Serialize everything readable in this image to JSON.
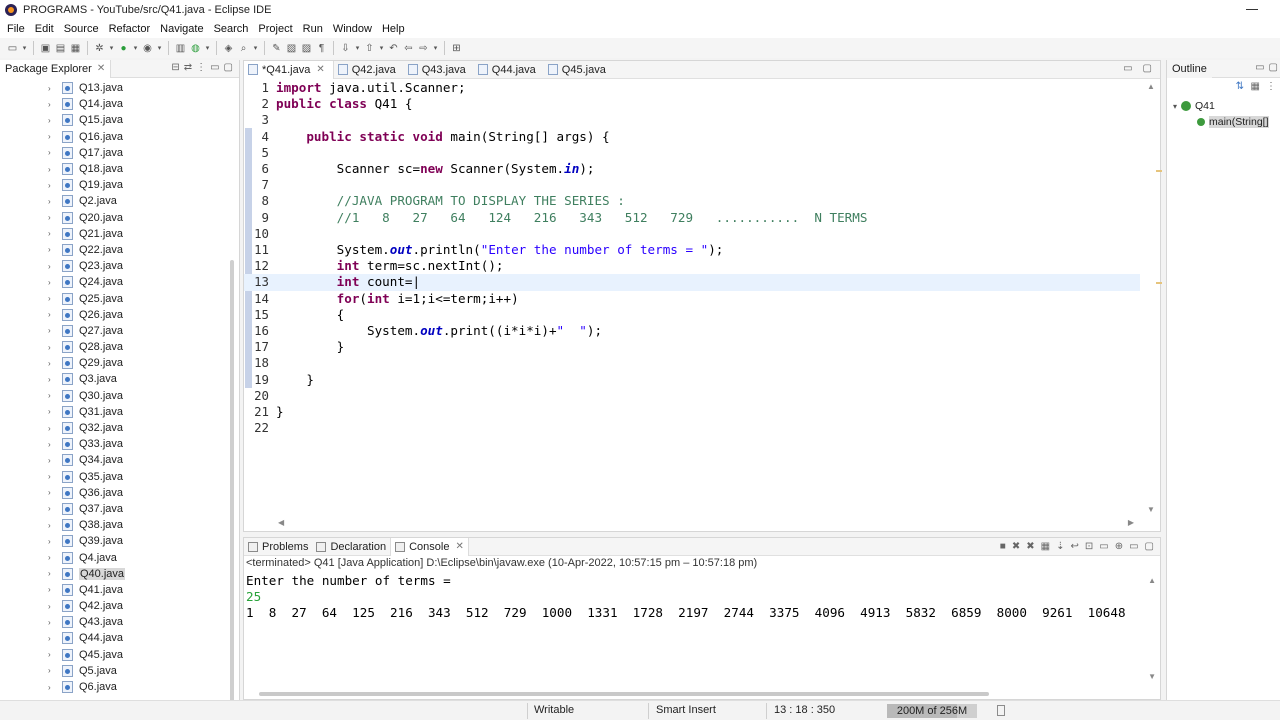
{
  "window": {
    "title": "PROGRAMS - YouTube/src/Q41.java - Eclipse IDE"
  },
  "menu": [
    "File",
    "Edit",
    "Source",
    "Refactor",
    "Navigate",
    "Search",
    "Project",
    "Run",
    "Window",
    "Help"
  ],
  "package_explorer": {
    "title": "Package Explorer",
    "items": [
      "Q13.java",
      "Q14.java",
      "Q15.java",
      "Q16.java",
      "Q17.java",
      "Q18.java",
      "Q19.java",
      "Q2.java",
      "Q20.java",
      "Q21.java",
      "Q22.java",
      "Q23.java",
      "Q24.java",
      "Q25.java",
      "Q26.java",
      "Q27.java",
      "Q28.java",
      "Q29.java",
      "Q3.java",
      "Q30.java",
      "Q31.java",
      "Q32.java",
      "Q33.java",
      "Q34.java",
      "Q35.java",
      "Q36.java",
      "Q37.java",
      "Q38.java",
      "Q39.java",
      "Q4.java",
      "Q40.java",
      "Q41.java",
      "Q42.java",
      "Q43.java",
      "Q44.java",
      "Q45.java",
      "Q5.java",
      "Q6.java"
    ],
    "selected": "Q40.java"
  },
  "editor": {
    "tabs": [
      "*Q41.java",
      "Q42.java",
      "Q43.java",
      "Q44.java",
      "Q45.java"
    ],
    "active_tab": "*Q41.java",
    "line_numbers": [
      "1",
      "2",
      "3",
      "4",
      "5",
      "6",
      "7",
      "8",
      "9",
      "10",
      "11",
      "12",
      "13",
      "14",
      "15",
      "16",
      "17",
      "18",
      "19",
      "20",
      "21",
      "22"
    ],
    "current_line": "13"
  },
  "console": {
    "tabs": [
      "Problems",
      "Declaration",
      "Console"
    ],
    "active_tab": "Console",
    "status": "<terminated> Q41 [Java Application] D:\\Eclipse\\bin\\javaw.exe  (10-Apr-2022, 10:57:15 pm – 10:57:18 pm)",
    "prompt": "Enter the number of terms = ",
    "input": "25",
    "output": "1  8  27  64  125  216  343  512  729  1000  1331  1728  2197  2744  3375  4096  4913  5832  6859  8000  9261  10648"
  },
  "outline": {
    "title": "Outline",
    "class_name": "Q41",
    "method": "main(String[]"
  },
  "statusbar": {
    "mode": "Writable",
    "insert": "Smart Insert",
    "position": "13 : 18 : 350",
    "heap": "200M of 256M",
    "heap_fraction": 0.78
  }
}
